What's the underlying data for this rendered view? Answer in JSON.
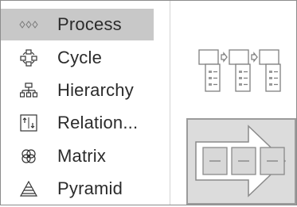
{
  "categories": [
    {
      "label": "Process",
      "icon": "process-icon",
      "selected": true
    },
    {
      "label": "Cycle",
      "icon": "cycle-icon",
      "selected": false
    },
    {
      "label": "Hierarchy",
      "icon": "hierarchy-icon",
      "selected": false
    },
    {
      "label": "Relation...",
      "icon": "relationship-icon",
      "selected": false
    },
    {
      "label": "Matrix",
      "icon": "matrix-icon",
      "selected": false
    },
    {
      "label": "Pyramid",
      "icon": "pyramid-icon",
      "selected": false
    }
  ],
  "gallery": {
    "items": [
      {
        "icon": "accent-process-thumbnail",
        "selected": false
      },
      {
        "icon": "basic-chevron-arrow-process-thumbnail",
        "selected": true
      }
    ]
  },
  "colors": {
    "selected_background": "#c8c8c8",
    "icon_gray": "#7f7f7f",
    "text": "#2b2b2b"
  }
}
